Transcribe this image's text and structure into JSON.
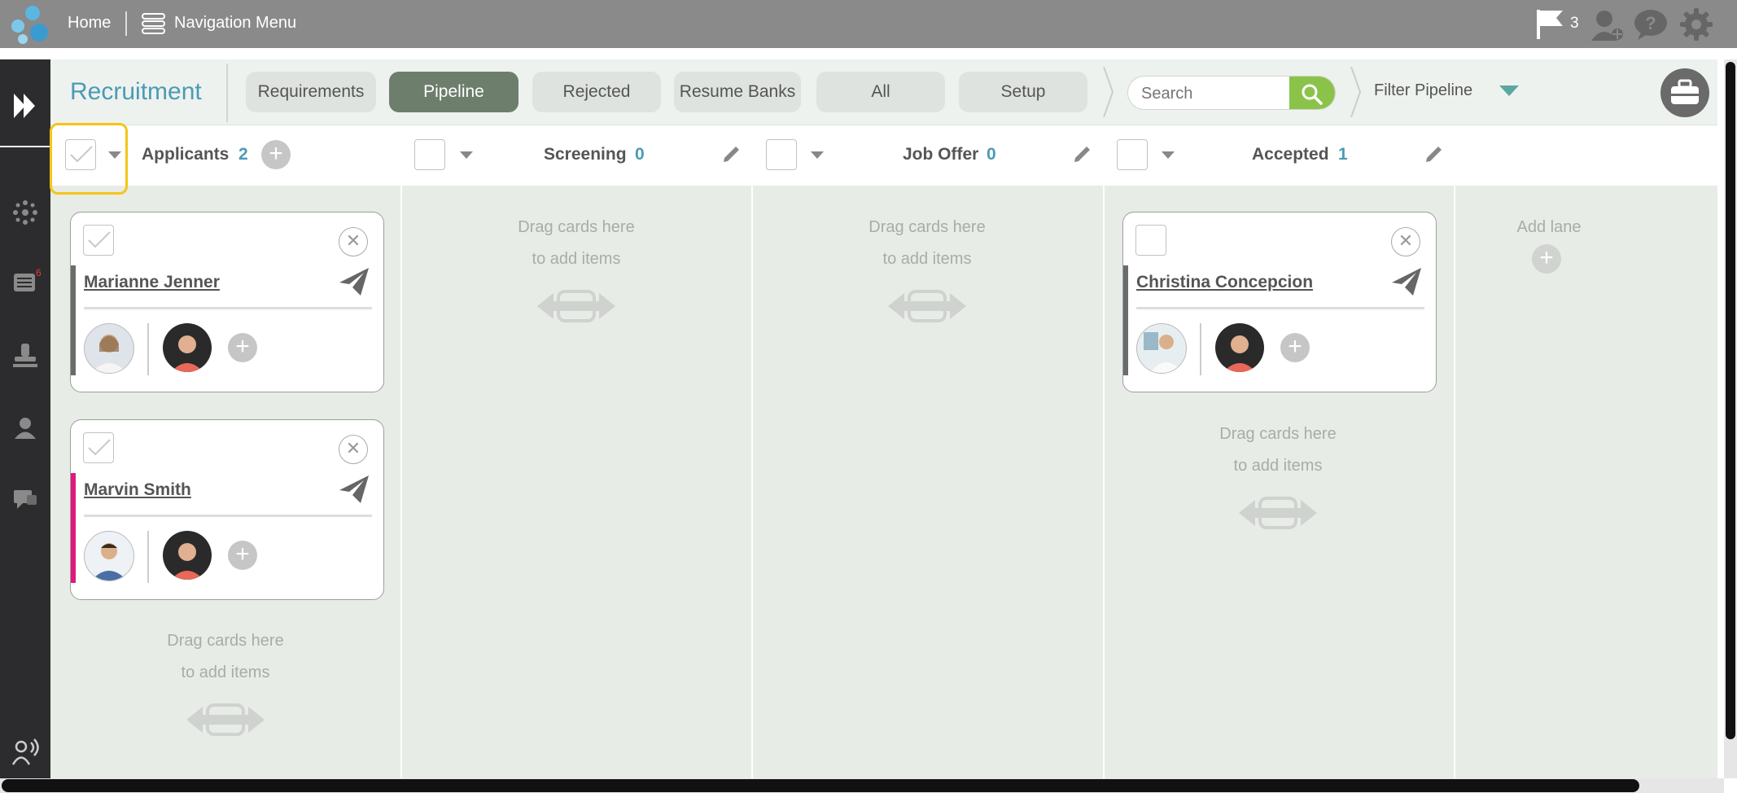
{
  "topbar": {
    "home": "Home",
    "nav_menu": "Navigation Menu",
    "flag_count": "3"
  },
  "app": {
    "title": "Recruitment"
  },
  "tabs": [
    {
      "label": "Requirements"
    },
    {
      "label": "Pipeline"
    },
    {
      "label": "Rejected"
    },
    {
      "label": "Resume Banks"
    },
    {
      "label": "All"
    },
    {
      "label": "Setup"
    }
  ],
  "search": {
    "placeholder": "Search"
  },
  "filter": {
    "label": "Filter Pipeline"
  },
  "sidebar": {
    "badge": "6"
  },
  "lanes": [
    {
      "title": "Applicants",
      "count": "2"
    },
    {
      "title": "Screening",
      "count": "0"
    },
    {
      "title": "Job Offer",
      "count": "0"
    },
    {
      "title": "Accepted",
      "count": "1"
    }
  ],
  "cards": [
    {
      "name": "Marianne Jenner"
    },
    {
      "name": "Marvin Smith"
    },
    {
      "name": "Christina Concepcion"
    }
  ],
  "drag": {
    "line1": "Drag cards here",
    "line2": "to add items"
  },
  "add_lane": "Add lane",
  "colors": {
    "accent": "#4a9bb5",
    "active_tab": "#6e7e6d",
    "search_btn": "#8bc34a",
    "highlight": "#f5c518",
    "card1_bar": "#6b6b6b",
    "card2_bar": "#e0197d",
    "card3_bar": "#6b6b6b"
  }
}
